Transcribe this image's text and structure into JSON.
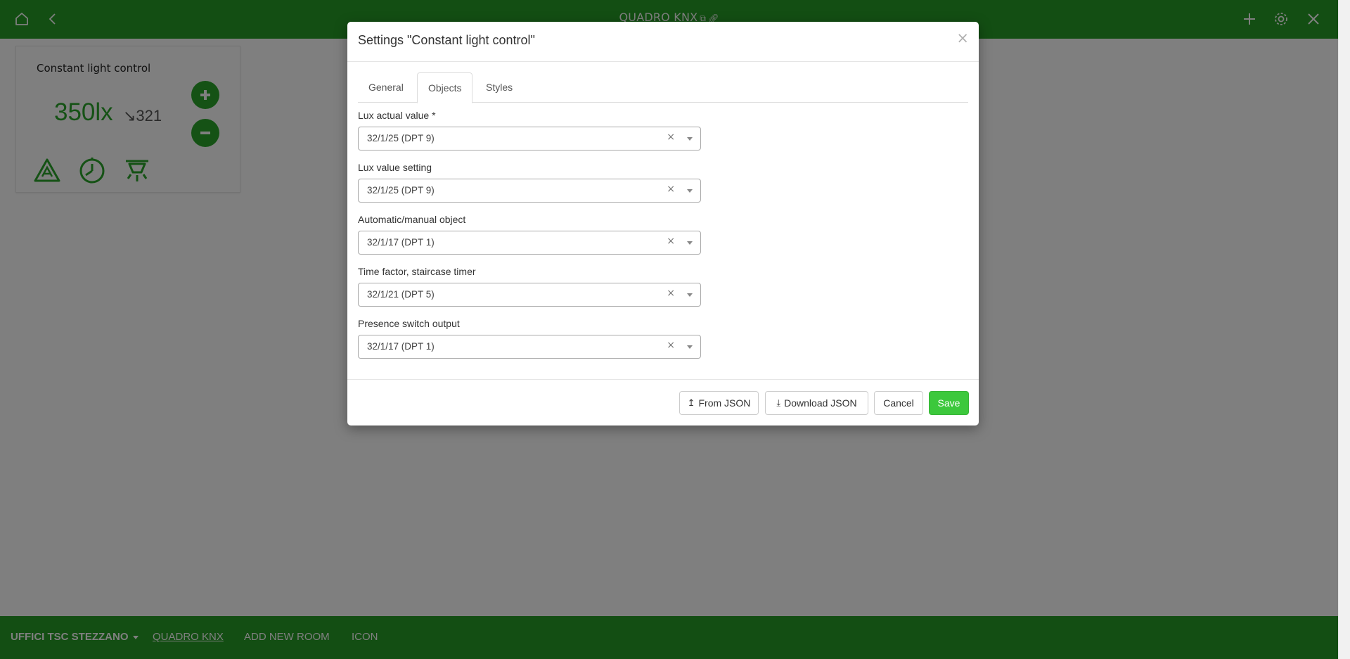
{
  "topbar": {
    "title": "QUADRO KNX",
    "title_icons": [
      "copy-icon",
      "link-icon"
    ],
    "left_icons": [
      "home-icon",
      "back-icon"
    ],
    "right_icons": [
      "plus-icon",
      "gear-icon",
      "close-icon"
    ],
    "color": "#279c27"
  },
  "widget": {
    "title": "Constant light control",
    "value": "350lx",
    "setpoint": "↘321",
    "buttons": [
      "plus-icon",
      "minus-icon"
    ],
    "icons": [
      "auto-mode-icon",
      "timer-icon",
      "ceiling-light-icon"
    ]
  },
  "bottombar": {
    "location": "UFFICI TSC STEZZANO",
    "items": [
      "QUADRO KNX",
      "ADD NEW ROOM",
      "ICON"
    ]
  },
  "modal": {
    "title": "Settings \"Constant light control\"",
    "close": "×",
    "tabs": [
      "General",
      "Objects",
      "Styles"
    ],
    "active_tab": "Objects",
    "fields": [
      {
        "label": "Lux actual value *",
        "value": "32/1/25 (DPT 9)"
      },
      {
        "label": "Lux value setting",
        "value": "32/1/25 (DPT 9)"
      },
      {
        "label": "Automatic/manual object",
        "value": "32/1/17 (DPT 1)"
      },
      {
        "label": "Time factor, staircase timer",
        "value": "32/1/21 (DPT 5)"
      },
      {
        "label": "Presence switch output",
        "value": "32/1/17 (DPT 1)"
      }
    ],
    "clear_glyph": "×",
    "buttons": {
      "from_json": "From JSON",
      "download_json": "Download JSON",
      "cancel": "Cancel",
      "save": "Save"
    },
    "button_glyphs": {
      "upload": "↥",
      "download": "⤓"
    },
    "save_color": "#3cc83c"
  }
}
